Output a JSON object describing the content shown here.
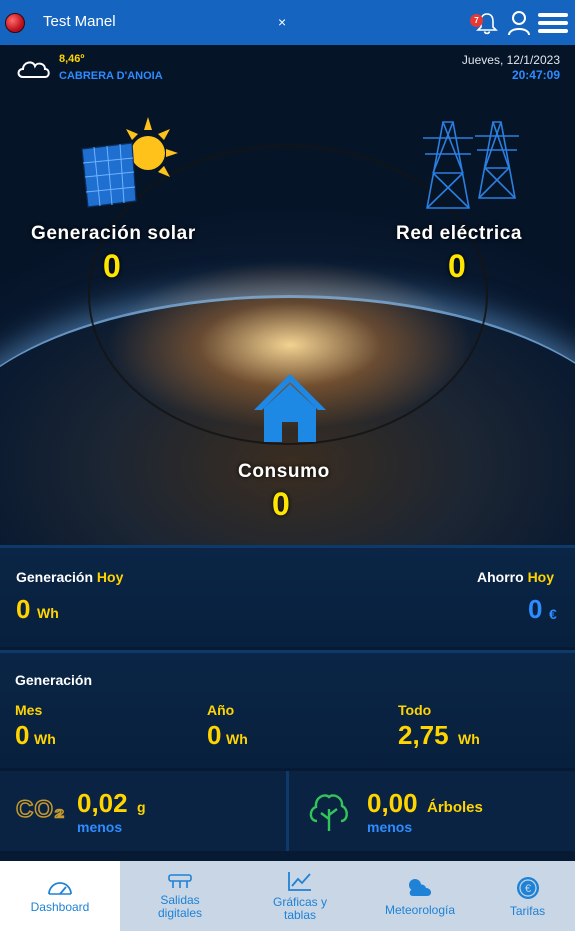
{
  "header": {
    "site_name": "Test Manel",
    "close_label": "×",
    "notification_count": "7"
  },
  "weather": {
    "temperature": "8,46º",
    "location": "CABRERA D'ANOIA",
    "date": "Jueves, 12/1/2023",
    "time": "20:47:09"
  },
  "energy": {
    "solar_label": "Generación solar",
    "solar_value": "0",
    "grid_label": "Red eléctrica",
    "grid_value": "0",
    "consumption_label": "Consumo",
    "consumption_value": "0"
  },
  "today": {
    "generation_label": "Generación",
    "generation_highlight": "Hoy",
    "generation_value": "0",
    "generation_unit": "Wh",
    "savings_label": "Ahorro",
    "savings_highlight": "Hoy",
    "savings_value": "0",
    "savings_unit": "€"
  },
  "generation_summary": {
    "title": "Generación",
    "month_label": "Mes",
    "month_value": "0",
    "month_unit": "Wh",
    "year_label": "Año",
    "year_value": "0",
    "year_unit": "Wh",
    "total_label": "Todo",
    "total_value": "2,75",
    "total_unit": "Wh"
  },
  "environment": {
    "co2_symbol": "CO₂",
    "co2_value": "0,02",
    "co2_unit": "g",
    "co2_caption": "menos",
    "trees_value": "0,00",
    "trees_unit": "Árboles",
    "trees_caption": "menos"
  },
  "nav": {
    "dashboard": "Dashboard",
    "digital_outputs_1": "Salidas",
    "digital_outputs_2": "digitales",
    "charts_1": "Gráficas y",
    "charts_2": "tablas",
    "weather": "Meteorología",
    "rates": "Tarifas"
  },
  "colors": {
    "accent_yellow": "#ffd400",
    "accent_blue": "#2d8cff",
    "topbar": "#1565c0"
  }
}
